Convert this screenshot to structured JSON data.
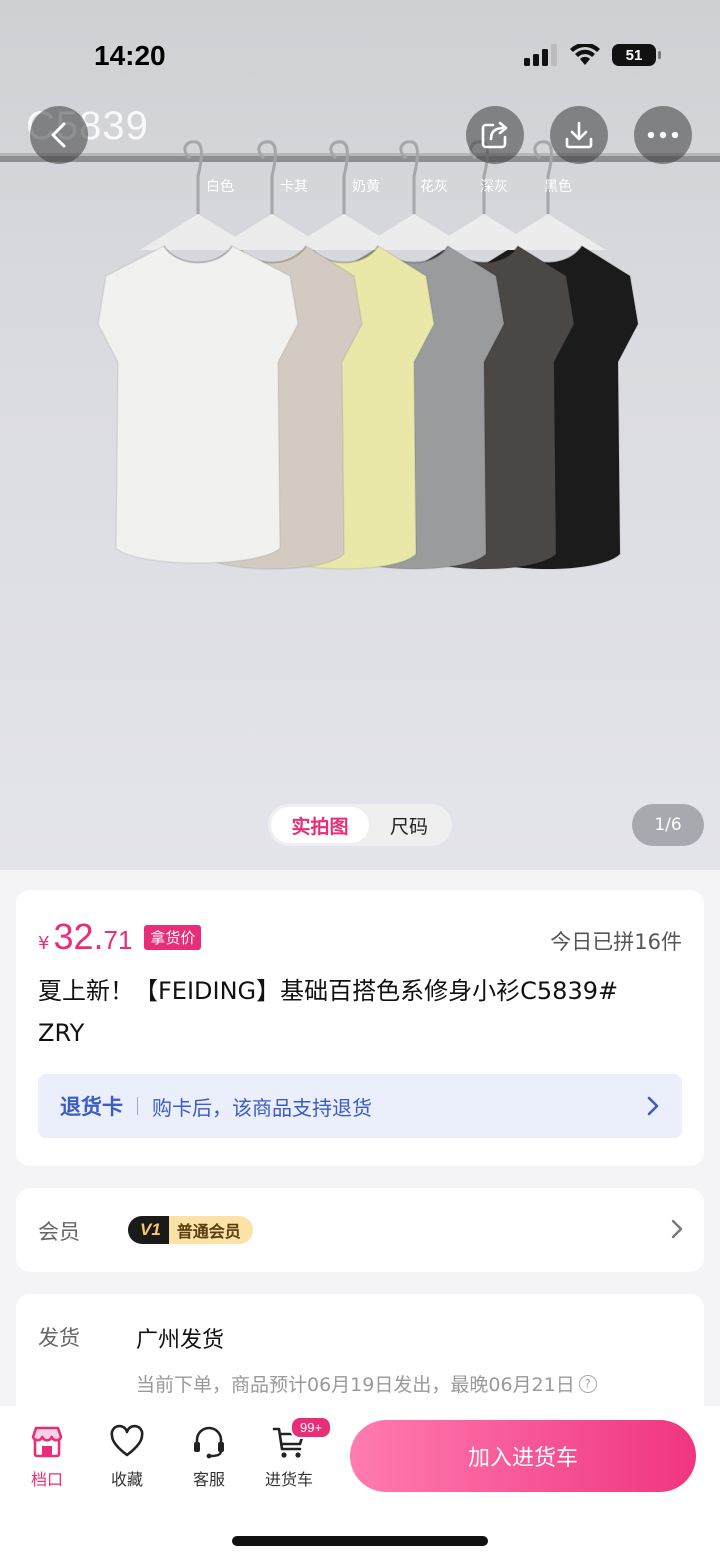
{
  "status_bar": {
    "time": "14:20",
    "battery": "51"
  },
  "hero": {
    "product_code_overlay": "C5839",
    "color_labels": [
      "白色",
      "卡其",
      "奶黄",
      "花灰",
      "深灰",
      "黑色"
    ],
    "colors": [
      "#f1f1ef",
      "#d3cbc1",
      "#e9e8a8",
      "#9a9b9d",
      "#4a4745",
      "#1b1b1c"
    ],
    "tabs": {
      "active": "实拍图",
      "inactive": "尺码"
    },
    "page_indicator": "1/6"
  },
  "price": {
    "currency": "¥",
    "integer": "32.",
    "decimal": "71",
    "tag": "拿货价",
    "sold_today": "今日已拼16件"
  },
  "product": {
    "title": "夏上新！【FEIDING】基础百搭色系修身小衫C5839#  ZRY"
  },
  "return_card": {
    "title": "退货卡",
    "description": "购卡后，该商品支持退货"
  },
  "member": {
    "label": "会员",
    "level": "V1",
    "level_name": "普通会员"
  },
  "shipping": {
    "label": "发货",
    "origin": "广州发货",
    "note": "当前下单，商品预计06月19日发出，最晚06月21日"
  },
  "bottom_nav": {
    "store": "档口",
    "favorite": "收藏",
    "service": "客服",
    "cart": "进货车",
    "cart_badge": "99+",
    "add_to_cart": "加入进货车"
  },
  "accent_color": "#e82e78"
}
